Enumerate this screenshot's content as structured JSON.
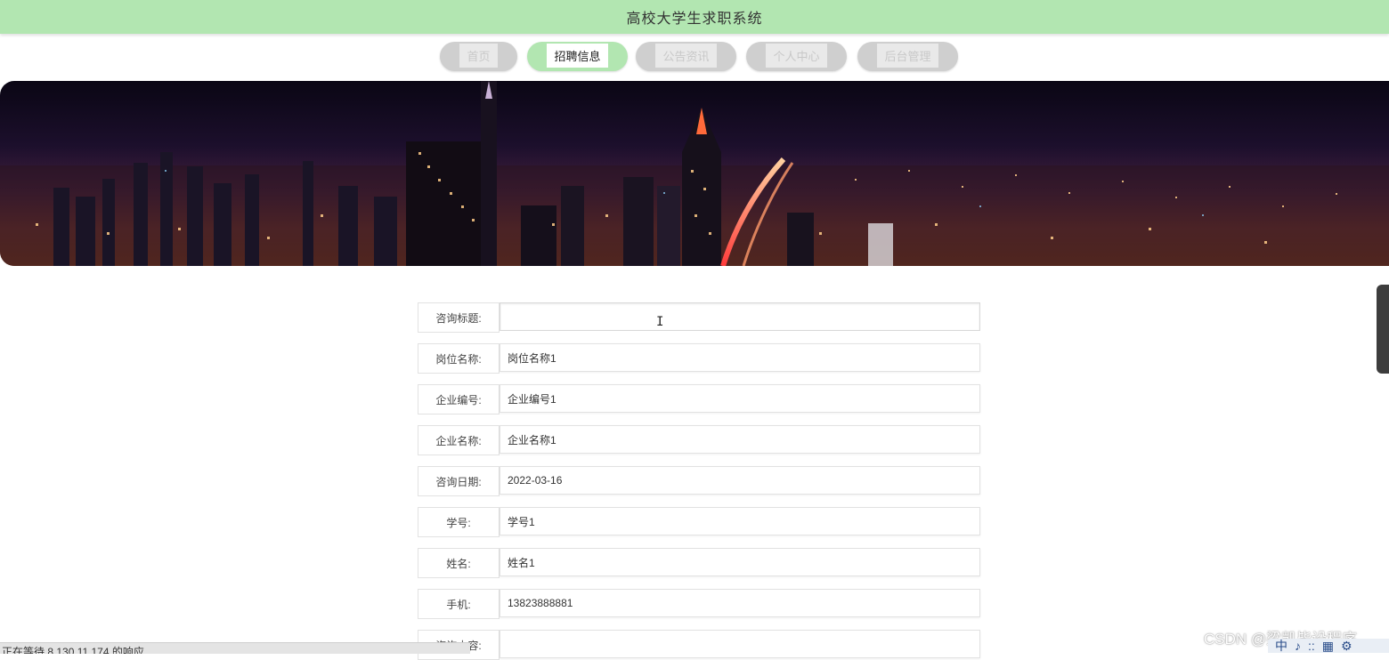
{
  "header": {
    "title": "高校大学生求职系统"
  },
  "nav": {
    "items": [
      {
        "label": "首页"
      },
      {
        "label": "招聘信息"
      },
      {
        "label": "公告资讯"
      },
      {
        "label": "个人中心"
      },
      {
        "label": "后台管理"
      }
    ],
    "active_index": 1
  },
  "form": {
    "fields": [
      {
        "label": "咨询标题:",
        "value": ""
      },
      {
        "label": "岗位名称:",
        "value": "岗位名称1"
      },
      {
        "label": "企业编号:",
        "value": "企业编号1"
      },
      {
        "label": "企业名称:",
        "value": "企业名称1"
      },
      {
        "label": "咨询日期:",
        "value": "2022-03-16"
      },
      {
        "label": "学号:",
        "value": "学号1"
      },
      {
        "label": "姓名:",
        "value": "姓名1"
      },
      {
        "label": "手机:",
        "value": "13823888881"
      },
      {
        "label": "咨询内容:",
        "value": ""
      }
    ]
  },
  "status": {
    "text": "正在等待 8.130.11.174 的响应..."
  },
  "watermark": {
    "text": "CSDN @梁凯毕设程序"
  },
  "tray": {
    "items": [
      "中",
      "♪",
      "::",
      "▦",
      "⚙"
    ]
  },
  "icons": {
    "cursor": "text-cursor-icon"
  },
  "colors": {
    "accent": "#b2e6b1",
    "nav_inactive": "#cfcfcf"
  }
}
